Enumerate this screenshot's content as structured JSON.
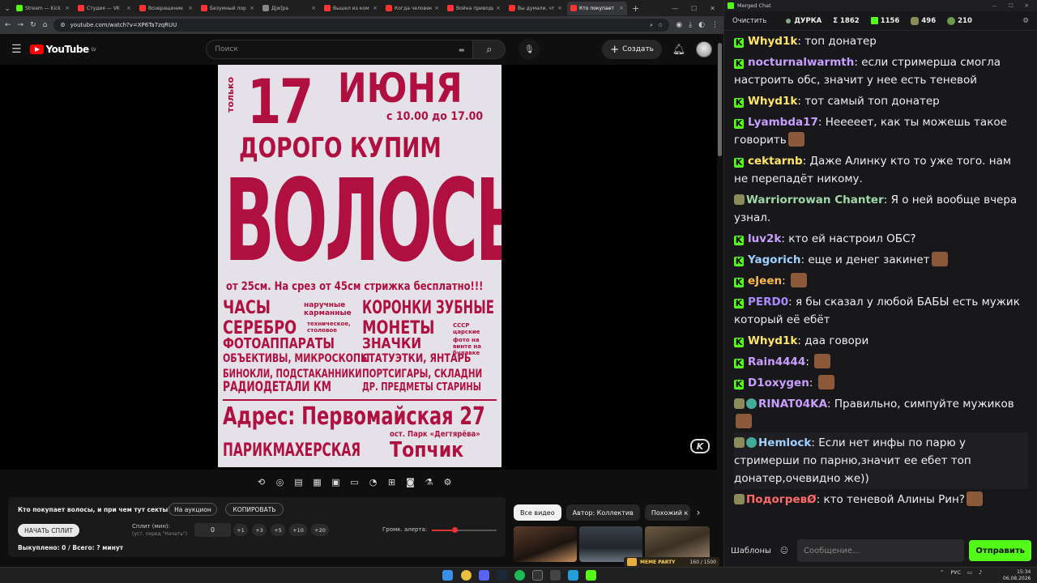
{
  "browser": {
    "tabs": [
      {
        "title": "Stream — Kick",
        "color": "#53fc18",
        "active": false
      },
      {
        "title": "Студия — VK",
        "color": "#ff3333",
        "active": false
      },
      {
        "title": "Возвращение",
        "color": "#ff3333",
        "active": false
      },
      {
        "title": "Безумный лор",
        "color": "#ff3333",
        "active": false
      },
      {
        "title": "Дjw]ра",
        "color": "#888888",
        "active": false
      },
      {
        "title": "Вышел из ком",
        "color": "#ff3333",
        "active": false
      },
      {
        "title": "Когда человек",
        "color": "#ff3333",
        "active": false
      },
      {
        "title": "Война приводи",
        "color": "#ff3333",
        "active": false
      },
      {
        "title": "Вы думали, чт",
        "color": "#ff3333",
        "active": false
      },
      {
        "title": "Кто покупает",
        "color": "#ff3333",
        "active": true
      }
    ],
    "url": "youtube.com/watch?v=XP6Ta7zqRUU"
  },
  "youtube": {
    "logo_text": "YouTube",
    "region": "LV",
    "search_placeholder": "Поиск",
    "create_label": "Создать"
  },
  "poster": {
    "only": "только",
    "day": "17",
    "month": "июня",
    "hours": "с 10.00 до 17.00",
    "buy": "ДОРОГО КУПИМ",
    "hair": "ВОЛОСЫ",
    "hair_note": "от 25см. На срез от 45см стрижка бесплатно!!!",
    "left_items": [
      "ЧАСЫ",
      "СЕРЕБРО",
      "ФОТОАППАРАТЫ",
      "ОБЪЕКТИВЫ, МИКРОСКОПЫ",
      "БИНОКЛИ, ПОДСТАКАННИКИ",
      "РАДИОДЕТАЛИ КМ"
    ],
    "left_notes": [
      "наручные карманные",
      "техническое, столовое"
    ],
    "right_items": [
      "КОРОНКИ ЗУБНЫЕ",
      "МОНЕТЫ",
      "ЗНАЧКИ",
      "СТАТУЭТКИ, ЯНТАРЬ",
      "ПОРТСИГАРЫ, СКЛАДНИ",
      "ДР. ПРЕДМЕТЫ СТАРИНЫ"
    ],
    "right_notes": [
      "СССР царские",
      "фото на винте на булавке"
    ],
    "address": "Адрес: Первомайская 27",
    "park": "ост. Парк «Дегтярёва»",
    "barber": "ПАРИКМАХЕРСКАЯ",
    "topchik": "Топчик"
  },
  "ext": {
    "question": "Кто покупает волосы, и при чем тут секты?",
    "auction": "На аукцион",
    "copy": "КОПИРОВАТЬ",
    "split": "НАЧАТЬ СПЛИТ",
    "minutes_label": "Сплит (мин):",
    "minutes_hint": "(уст. перед \"Начать\")",
    "minutes_value": "0",
    "increments": [
      "+1",
      "+3",
      "+5",
      "+10",
      "+20"
    ],
    "volume_label": "Громк. алерта:",
    "volume_level": 0.35,
    "status": "Выкуплено: 0 / Всего: ? минут"
  },
  "recs": {
    "chips": [
      "Все видео",
      "Автор: Коллектив",
      "Похожий к"
    ],
    "meme_party": "MEME PARTY",
    "meme_count": "160 / 1500"
  },
  "chat": {
    "window_title": "Merged Chat",
    "clear": "Очистить",
    "channel": "ДУРКА",
    "sigma": "Σ 1862",
    "kick": "1156",
    "twitch": "496",
    "other": "210",
    "messages": [
      {
        "name": "Whyd1k",
        "color": "#ffe566",
        "badge": "kick",
        "text": "топ донатер"
      },
      {
        "name": "nocturnalwarmth",
        "color": "#c89fff",
        "badge": "kick",
        "text": "если стримерша смогла настроить обс, значит у нее есть теневой"
      },
      {
        "name": "Whyd1k",
        "color": "#ffe566",
        "badge": "kick",
        "text": "тот самый топ донатер"
      },
      {
        "name": "Lyambda17",
        "color": "#c89fff",
        "badge": "kick",
        "text": "Нееееет, как ты можешь такое говорить",
        "emote": true
      },
      {
        "name": "cektarnb",
        "color": "#ffe566",
        "badge": "kick",
        "text": "Даже Алинку кто то уже того. нам не перепадёт никому."
      },
      {
        "name": "Warriorrowan Chanter",
        "color": "#9fd8a8",
        "badge": "ext",
        "text": "Я о ней вообще вчера узнал."
      },
      {
        "name": "luv2k",
        "color": "#c89fff",
        "badge": "kick",
        "text": "кто ей настроил ОБС?"
      },
      {
        "name": "Yagorich",
        "color": "#9fd0ff",
        "badge": "kick",
        "text": "еще и денег закинет",
        "emote": true
      },
      {
        "name": "eJeen",
        "color": "#ffb84d",
        "badge": "kick",
        "text": "",
        "emote": true
      },
      {
        "name": "PERD0",
        "color": "#a98bff",
        "badge": "kick",
        "text": "я бы сказал у любой БАБЫ есть мужик который её ебёт"
      },
      {
        "name": "Whyd1k",
        "color": "#ffe566",
        "badge": "kick",
        "text": "даа говори"
      },
      {
        "name": "Rain4444",
        "color": "#c89fff",
        "badge": "kick",
        "text": "",
        "emote": true
      },
      {
        "name": "D1oxygen",
        "color": "#c89fff",
        "badge": "kick",
        "text": "",
        "emote": true
      },
      {
        "name": "RINAT04KA",
        "color": "#c89fff",
        "badge": "vip",
        "text": "Правильно, симпуйте мужиков",
        "emote": true
      },
      {
        "name": "Hemlock",
        "color": "#9fd0ff",
        "badge": "vip",
        "text": "Если нет инфы по парю у стримерши по парню,значит ее ебет топ донатер,очевидно же))",
        "hl": true
      },
      {
        "name": "ПодогревØ",
        "color": "#ff6b6b",
        "badge": "ext",
        "text": "кто теневой Алины Рин?",
        "emote": true
      }
    ],
    "templates": "Шаблоны",
    "input_placeholder": "Сообщение...",
    "send": "Отправить"
  },
  "taskbar": {
    "lang": "РУС",
    "time": "15:34",
    "date": "06.08.2026"
  }
}
